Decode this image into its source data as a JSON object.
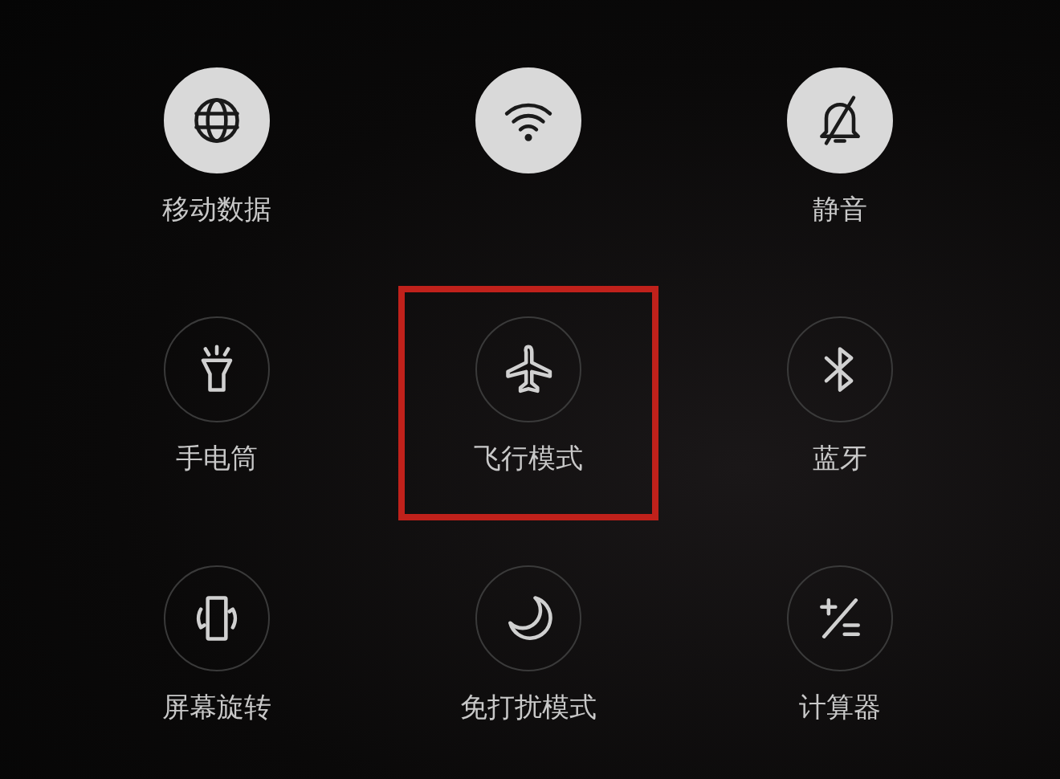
{
  "tiles": [
    {
      "kind": "globe",
      "label": "移动数据",
      "on": true,
      "highlighted": false
    },
    {
      "kind": "wifi",
      "on": true,
      "highlighted": false
    },
    {
      "kind": "bell-off",
      "label": "静音",
      "on": true,
      "highlighted": false
    },
    {
      "kind": "flashlight",
      "label": "手电筒",
      "on": false,
      "highlighted": false
    },
    {
      "kind": "airplane",
      "label": "飞行模式",
      "on": false,
      "highlighted": true
    },
    {
      "kind": "bluetooth",
      "label": "蓝牙",
      "on": false,
      "highlighted": false
    },
    {
      "kind": "rotate",
      "label": "屏幕旋转",
      "on": false,
      "highlighted": false
    },
    {
      "kind": "moon",
      "label": "免打扰模式",
      "on": false,
      "highlighted": false
    },
    {
      "kind": "calculator",
      "label": "计算器",
      "on": false,
      "highlighted": false
    }
  ]
}
